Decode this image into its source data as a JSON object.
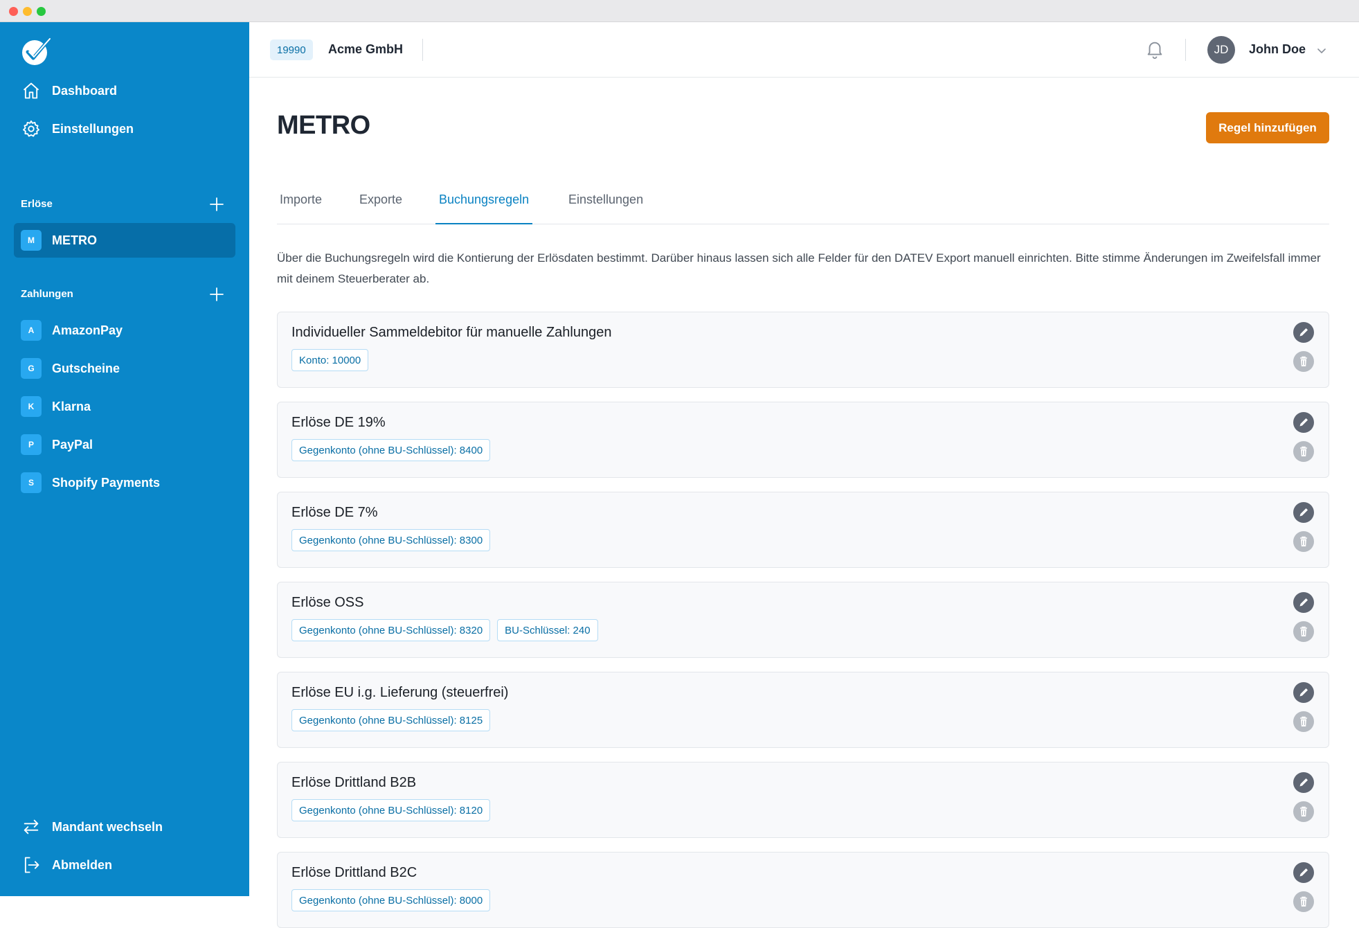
{
  "sidebar": {
    "logo_icon": "checkmark-logo-icon",
    "nav": [
      {
        "label": "Dashboard",
        "icon": "home-icon"
      },
      {
        "label": "Einstellungen",
        "icon": "gear-icon"
      }
    ],
    "sections": [
      {
        "title": "Erlöse",
        "items": [
          {
            "badge": "M",
            "label": "METRO",
            "active": true
          }
        ]
      },
      {
        "title": "Zahlungen",
        "items": [
          {
            "badge": "A",
            "label": "AmazonPay"
          },
          {
            "badge": "G",
            "label": "Gutscheine"
          },
          {
            "badge": "K",
            "label": "Klarna"
          },
          {
            "badge": "P",
            "label": "PayPal"
          },
          {
            "badge": "S",
            "label": "Shopify Payments"
          }
        ]
      }
    ],
    "footer": [
      {
        "label": "Mandant wechseln",
        "icon": "switch-arrows-icon"
      },
      {
        "label": "Abmelden",
        "icon": "logout-icon"
      }
    ]
  },
  "header": {
    "client_number": "19990",
    "client_name": "Acme GmbH",
    "user_initials": "JD",
    "user_name": "John Doe"
  },
  "page": {
    "title": "METRO",
    "add_button": "Regel hinzufügen",
    "tabs": [
      "Importe",
      "Exporte",
      "Buchungsregeln",
      "Einstellungen"
    ],
    "active_tab": 2,
    "intro": "Über die Buchungsregeln wird die Kontierung der Erlösdaten bestimmt. Darüber hinaus lassen sich alle Felder für den DATEV Export manuell einrichten. Bitte stimme Änderungen im Zweifelsfall immer mit deinem Steuerberater ab."
  },
  "rules": [
    {
      "title": "Individueller Sammeldebitor für manuelle Zahlungen",
      "chips": [
        "Konto: 10000"
      ]
    },
    {
      "title": "Erlöse DE 19%",
      "chips": [
        "Gegenkonto (ohne BU-Schlüssel): 8400"
      ]
    },
    {
      "title": "Erlöse DE 7%",
      "chips": [
        "Gegenkonto (ohne BU-Schlüssel): 8300"
      ]
    },
    {
      "title": "Erlöse OSS",
      "chips": [
        "Gegenkonto (ohne BU-Schlüssel): 8320",
        "BU-Schlüssel: 240"
      ]
    },
    {
      "title": "Erlöse EU i.g. Lieferung (steuerfrei)",
      "chips": [
        "Gegenkonto (ohne BU-Schlüssel): 8125"
      ]
    },
    {
      "title": "Erlöse Drittland B2B",
      "chips": [
        "Gegenkonto (ohne BU-Schlüssel): 8120"
      ]
    },
    {
      "title": "Erlöse Drittland B2C",
      "chips": [
        "Gegenkonto (ohne BU-Schlüssel): 8000"
      ]
    }
  ],
  "colors": {
    "sidebar": "#0a87c9",
    "accent": "#0a82c2",
    "button": "#e07a0e"
  }
}
